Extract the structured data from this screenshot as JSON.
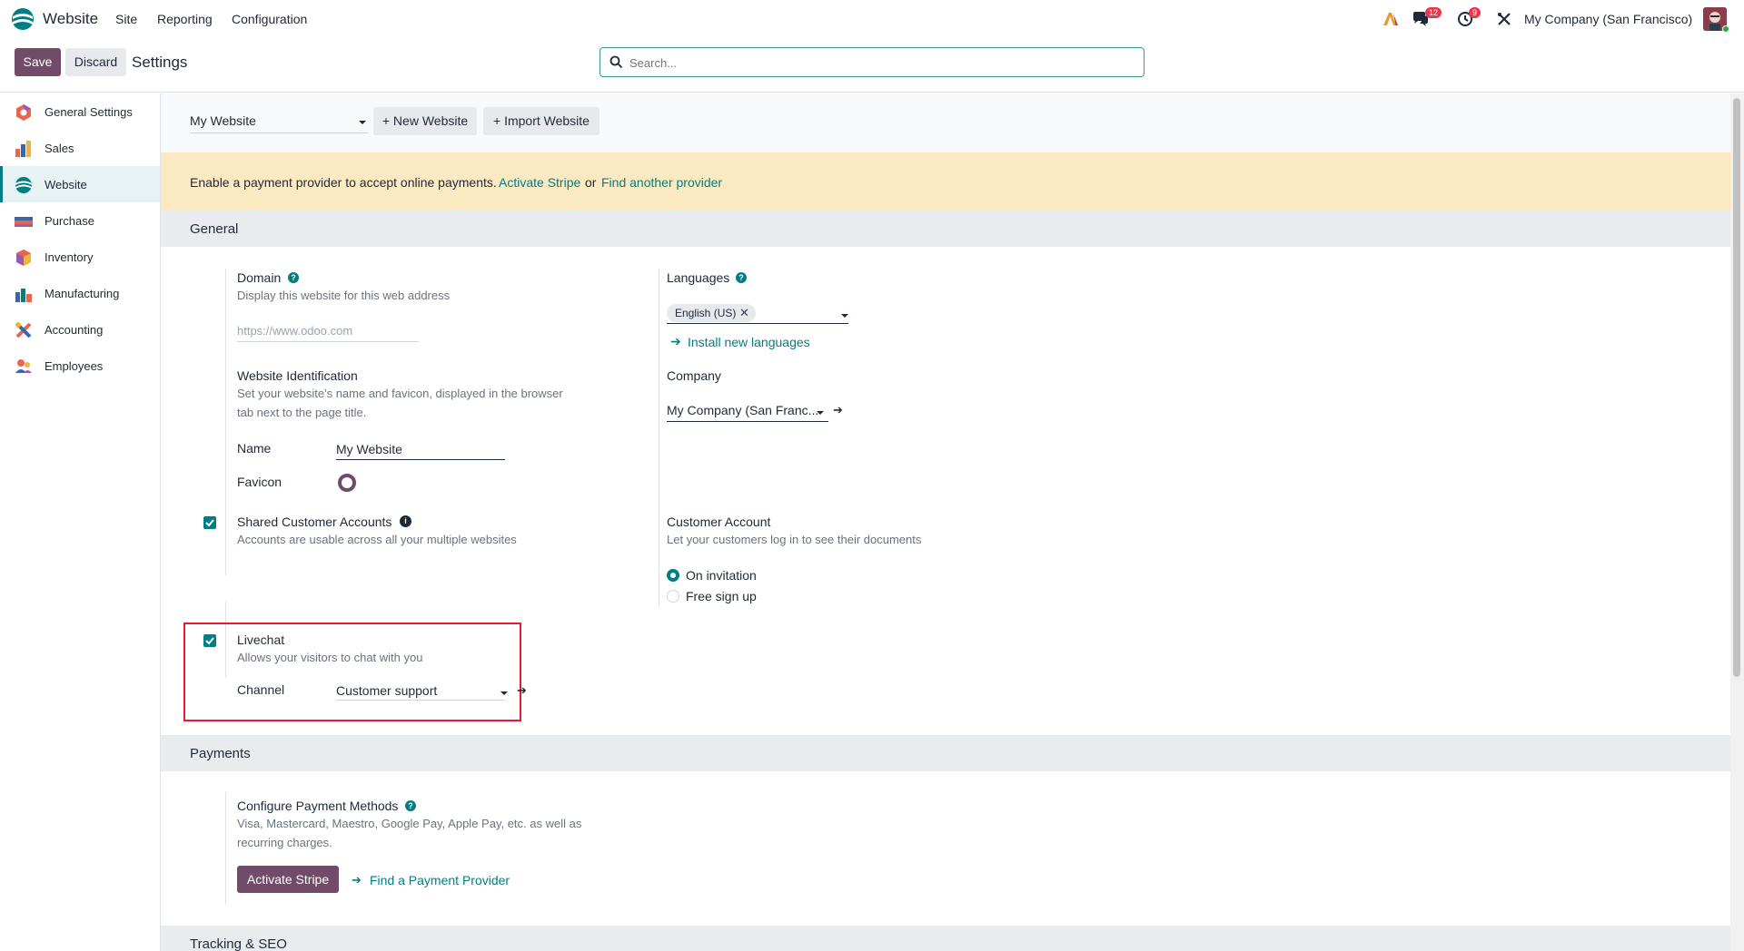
{
  "topnav": {
    "app_name": "Website",
    "menus": [
      "Site",
      "Reporting",
      "Configuration"
    ],
    "chat_badge": "12",
    "activity_badge": "9",
    "company": "My Company (San Francisco)"
  },
  "controlpanel": {
    "save_label": "Save",
    "discard_label": "Discard",
    "breadcrumb": "Settings",
    "search_placeholder": "Search..."
  },
  "sidebar": {
    "items": [
      {
        "label": "General Settings",
        "icon": "general-settings-icon"
      },
      {
        "label": "Sales",
        "icon": "sales-icon"
      },
      {
        "label": "Website",
        "icon": "website-icon",
        "active": true
      },
      {
        "label": "Purchase",
        "icon": "purchase-icon"
      },
      {
        "label": "Inventory",
        "icon": "inventory-icon"
      },
      {
        "label": "Manufacturing",
        "icon": "manufacturing-icon"
      },
      {
        "label": "Accounting",
        "icon": "accounting-icon"
      },
      {
        "label": "Employees",
        "icon": "employees-icon"
      }
    ]
  },
  "website_bar": {
    "selected_website": "My Website",
    "new_website": "+ New Website",
    "import_website": "+ Import Website"
  },
  "alert": {
    "text": "Enable a payment provider to accept online payments.",
    "activate_link": "Activate Stripe",
    "or": "or",
    "find_link": "Find another provider"
  },
  "general": {
    "title": "General",
    "domain_title": "Domain",
    "domain_desc": "Display this website for this web address",
    "domain_placeholder": "https://www.odoo.com",
    "languages_title": "Languages",
    "language_tag": "English (US)",
    "install_languages": "Install new languages",
    "identification_title": "Website Identification",
    "identification_desc_1": "Set your website's name and favicon, displayed in the browser",
    "identification_desc_2": "tab next to the page title.",
    "name_label": "Name",
    "name_value": "My Website",
    "favicon_label": "Favicon",
    "company_title": "Company",
    "company_value": "My Company (San Franc...",
    "shared_title": "Shared Customer Accounts",
    "shared_desc": "Accounts are usable across all your multiple websites",
    "customer_account_title": "Customer Account",
    "customer_account_desc": "Let your customers log in to see their documents",
    "radio_on_invitation": "On invitation",
    "radio_free_signup": "Free sign up",
    "livechat_title": "Livechat",
    "livechat_desc": "Allows your visitors to chat with you",
    "channel_label": "Channel",
    "channel_value": "Customer support"
  },
  "payments": {
    "title": "Payments",
    "configure_title": "Configure Payment Methods",
    "configure_desc_1": "Visa, Mastercard, Maestro, Google Pay, Apple Pay, etc. as well as",
    "configure_desc_2": "recurring charges.",
    "activate_button": "Activate Stripe",
    "find_provider": "Find a Payment Provider"
  },
  "tracking": {
    "title": "Tracking & SEO"
  },
  "colors": {
    "primary": "#714b67",
    "accent": "#017e84",
    "highlight_box": "#e8192c"
  }
}
